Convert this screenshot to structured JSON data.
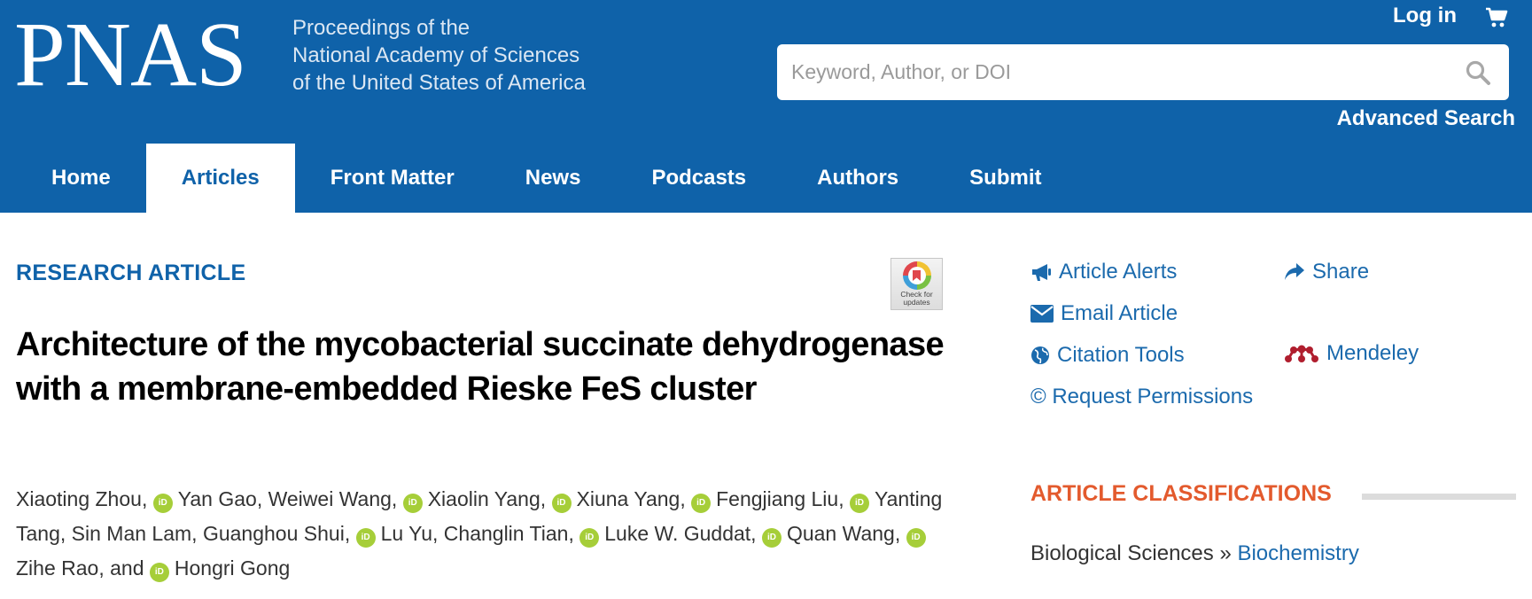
{
  "header": {
    "logo": "PNAS",
    "tagline": [
      "Proceedings of the",
      "National Academy of Sciences",
      "of the United States of America"
    ],
    "login": "Log in",
    "search_placeholder": "Keyword, Author, or DOI",
    "advanced_search": "Advanced Search",
    "bg_color": "#0f62a9"
  },
  "nav": [
    {
      "label": "Home",
      "active": false
    },
    {
      "label": "Articles",
      "active": true
    },
    {
      "label": "Front Matter",
      "active": false
    },
    {
      "label": "News",
      "active": false
    },
    {
      "label": "Podcasts",
      "active": false
    },
    {
      "label": "Authors",
      "active": false
    },
    {
      "label": "Submit",
      "active": false
    }
  ],
  "article": {
    "type_label": "RESEARCH ARTICLE",
    "check_updates": [
      "Check for",
      "updates"
    ],
    "title": "Architecture of the mycobacterial succinate dehydrogenase with a membrane-embedded Rieske FeS cluster",
    "authors": [
      {
        "name": "Xiaoting Zhou",
        "orcid": false
      },
      {
        "name": "Yan Gao",
        "orcid": true
      },
      {
        "name": "Weiwei Wang",
        "orcid": false
      },
      {
        "name": "Xiaolin Yang",
        "orcid": true
      },
      {
        "name": "Xiuna Yang",
        "orcid": true
      },
      {
        "name": "Fengjiang Liu",
        "orcid": true
      },
      {
        "name": "Yanting Tang",
        "orcid": true
      },
      {
        "name": "Sin Man Lam",
        "orcid": false
      },
      {
        "name": "Guanghou Shui",
        "orcid": false
      },
      {
        "name": "Lu Yu",
        "orcid": true
      },
      {
        "name": "Changlin Tian",
        "orcid": false
      },
      {
        "name": "Luke W. Guddat",
        "orcid": true
      },
      {
        "name": "Quan Wang",
        "orcid": true
      },
      {
        "name": "Zihe Rao",
        "orcid": true
      },
      {
        "name": "Hongri Gong",
        "orcid": true
      }
    ],
    "orcid_glyph": "iD"
  },
  "tools": {
    "article_alerts": "Article Alerts",
    "share": "Share",
    "email_article": "Email Article",
    "citation_tools": "Citation Tools",
    "mendeley": "Mendeley",
    "request_permissions": "© Request Permissions"
  },
  "classifications": {
    "title": "ARTICLE CLASSIFICATIONS",
    "category": "Biological Sciences",
    "separator": " » ",
    "subcategory": "Biochemistry"
  }
}
